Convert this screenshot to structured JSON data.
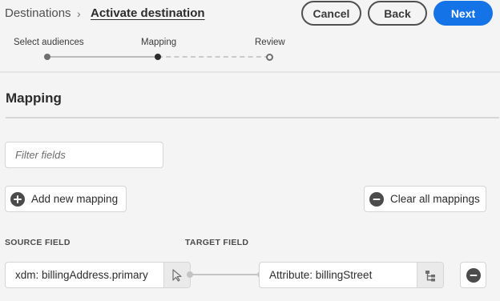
{
  "breadcrumb": {
    "root": "Destinations",
    "separator": "›",
    "current": "Activate destination"
  },
  "actions": {
    "cancel_label": "Cancel",
    "back_label": "Back",
    "next_label": "Next",
    "primary_color": "#1473e6"
  },
  "stepper": {
    "steps": [
      {
        "label": "Select audiences",
        "status": "complete"
      },
      {
        "label": "Mapping",
        "status": "current"
      },
      {
        "label": "Review",
        "status": "upcoming"
      }
    ]
  },
  "mapping": {
    "title": "Mapping",
    "filter": {
      "placeholder": "Filter fields",
      "value": ""
    },
    "add_label": "Add new mapping",
    "clear_label": "Clear all mappings",
    "columns": {
      "source": "SOURCE FIELD",
      "target": "TARGET FIELD"
    },
    "rows": [
      {
        "source": "xdm: billingAddress.primary",
        "target": "Attribute: billingStreet"
      }
    ]
  },
  "icons": {
    "add": "add-circle-icon",
    "clear": "remove-circle-icon",
    "source_picker": "cursor-pointer-icon",
    "target_picker": "schema-tree-icon",
    "remove_row": "remove-circle-icon"
  }
}
